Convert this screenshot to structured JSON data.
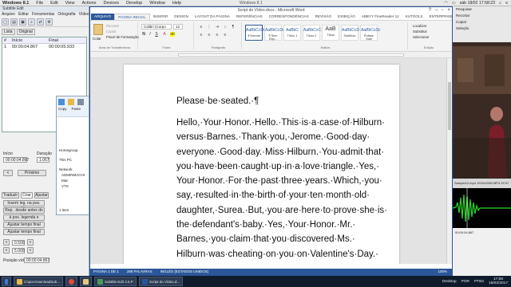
{
  "mac_menubar": {
    "items": [
      "Windows 8.1",
      "File",
      "Edit",
      "View",
      "Actions",
      "Devices",
      "Develop",
      "Window",
      "Help"
    ],
    "window_title": "Windows 8.1",
    "clock": "sáb 18/02  17:58:23"
  },
  "subtitle_edit": {
    "title": "Subtitle Edit",
    "menu": [
      "Arquivo",
      "Editar",
      "Ferramentas",
      "Ortografia",
      "Vídeo"
    ],
    "tabs": [
      "Lista",
      "Original"
    ],
    "columns": [
      "#",
      "Início",
      "Final"
    ],
    "rows": [
      {
        "n": "1",
        "start": "00:00:04.867",
        "end": "00:00:05.933"
      }
    ],
    "start_label": "Início",
    "start_value": "00:00:04.867",
    "duration_label": "Duração",
    "duration_value": "1.067",
    "prev_button": "<",
    "next_button": "Próximo",
    "bottom_tabs": [
      "Traduzir",
      "Criar",
      "Ajustar"
    ],
    "actions": [
      "Inserir leg. na pos. vídeo",
      "Rep.. desde antes do texto",
      "à pos. legenda e pausar",
      "Ajustar tempo final",
      "Ajustar tempo final"
    ],
    "step_a": "0.500",
    "step_b": "5.000",
    "position_label": "Posição vídeo",
    "position_value": "00:00:04.867"
  },
  "explorer": {
    "buttons": [
      "Copy",
      "Paste"
    ],
    "items": [
      "Homegroup",
      "This PC",
      "Network",
      "ADMINMACHI",
      "Mac",
      "VTS"
    ],
    "status": "1 item"
  },
  "word": {
    "title": "Script do Vídeo.docx - Microsoft Word",
    "tabs": [
      "ARQUIVO",
      "PÁGINA INICIAL",
      "INSERIR",
      "DESIGN",
      "LAYOUT DA PÁGINA",
      "REFERÊNCIAS",
      "CORRESPONDÊNCIAS",
      "REVISÃO",
      "EXIBIÇÃO",
      "ABBYY FineReader 12",
      "KUTOOLS",
      "ENTERPRISE"
    ],
    "clipboard_group": "Área de Transferência",
    "font_name": "Calibri (Corpo",
    "font_size": "12",
    "font_group": "Fonte",
    "paragraph_group": "Parágrafo",
    "styles_group": "Estilos",
    "edit_group": "Edição",
    "styles": [
      {
        "sample": "AaBbCcDc",
        "name": "¶ Normal"
      },
      {
        "sample": "AaBbCcDc",
        "name": "¶ Sem Esp..."
      },
      {
        "sample": "AaBbC",
        "name": "Título 1"
      },
      {
        "sample": "AaBbCcC",
        "name": "Título 2"
      },
      {
        "sample": "AaB",
        "name": "Título"
      },
      {
        "sample": "AaBbCcD",
        "name": "Subtítulo"
      },
      {
        "sample": "AaBbCcDc",
        "name": "Ênfase Sutil"
      }
    ],
    "edit_buttons": [
      "Localizar",
      "Substituir",
      "Selecionar"
    ],
    "clipboard_buttons": [
      "Colar",
      "Recortar",
      "Copiar",
      "Pincel de Formatação"
    ],
    "heading": "Please·be·seated.·¶",
    "body_lines": [
      "Hello,·Your·Honor.·Hello.·This·is·a·case·of·Hilburn·",
      "versus·Barnes.·Thank·you,·Jerome.·Good·day·",
      "everyone.·Good·day.·Miss·Hilburn.·You·admit·that·",
      "you·have·been·caught·up·in·a·love·triangle.·Yes,·",
      "Your·Honor.·For·the·past·three·years.·Which,·you·",
      "say,·resulted·in·the·birth·of·your·ten·month·old·",
      "daughter,·Surea.·But,·you·are·here·to·prove·she·is·",
      "the·defendant's·baby.·Yes,·Your·Honor.·Mr.·",
      "Barnes,·you·claim·that·you·discovered·Ms.·",
      "Hilburn·was·cheating·on·you·on·Valentine's·Day.·"
    ],
    "status": [
      "PÁGINA 1 DE 1",
      "288 PALAVRAS",
      "INGLÊS (ESTADOS UNIDOS)"
    ],
    "zoom": "100%"
  },
  "right_panel": {
    "items": [
      "Pesquisar",
      "Recortar",
      "Copiar",
      "Seleção"
    ],
    "video_info": "Sample12.mp4 1920x1080 MP4 29.97",
    "time_label": "00:00:04.867"
  },
  "taskbar": {
    "buttons": [
      "Cópia-DownloadSub...",
      "",
      "",
      "Subtitle Edit 3.5.P",
      "Script do Vídeo.d..."
    ],
    "tray": [
      "Desktop",
      "POR",
      "PTB2",
      "17:58",
      "18/02/2017"
    ]
  }
}
